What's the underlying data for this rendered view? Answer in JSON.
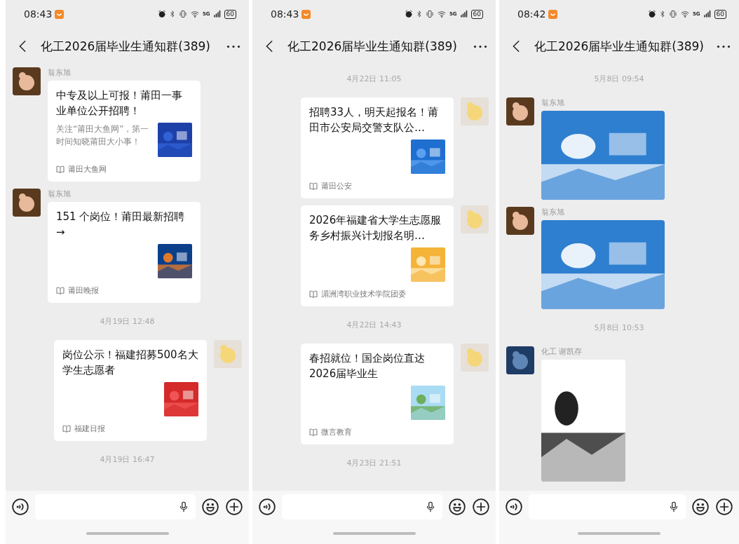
{
  "panels": [
    {
      "status_bar": {
        "time": "08:43",
        "network": "5G",
        "battery": "60"
      },
      "header": {
        "title": "化工2026届毕业生通知群(389)"
      },
      "messages": [
        {
          "kind": "article_in",
          "sender": "翁东旭",
          "title": "中专及以上可报！莆田一事业单位公开招聘！",
          "summary": "关注“莆田大鱼网”，第一时间知晓莆田大小事！",
          "source": "莆田大鱼网"
        },
        {
          "kind": "article_in",
          "sender": "翁东旭",
          "title": "151 个岗位！莆田最新招聘→",
          "source": "莆田晚报"
        },
        {
          "kind": "timestamp",
          "text": "4月19日 12:48"
        },
        {
          "kind": "article_out",
          "title": "岗位公示！福建招募500名大学生志愿者",
          "source": "福建日报"
        },
        {
          "kind": "timestamp",
          "text": "4月19日 16:47"
        }
      ]
    },
    {
      "status_bar": {
        "time": "08:43",
        "network": "5G",
        "battery": "60"
      },
      "header": {
        "title": "化工2026届毕业生通知群(389)"
      },
      "messages": [
        {
          "kind": "timestamp",
          "text": "4月22日 11:05"
        },
        {
          "kind": "article_out",
          "title": "招聘33人，明天起报名！莆田市公安局交警支队公…",
          "source": "莆田公安"
        },
        {
          "kind": "article_out",
          "title": "2026年福建省大学生志愿服务乡村振兴计划报名明…",
          "source": "湄洲湾职业技术学院团委"
        },
        {
          "kind": "timestamp",
          "text": "4月22日 14:43"
        },
        {
          "kind": "article_out",
          "title": "春招就位！国企岗位直达2026届毕业生",
          "source": "微言教育"
        },
        {
          "kind": "timestamp",
          "text": "4月23日 21:51"
        }
      ]
    },
    {
      "status_bar": {
        "time": "08:42",
        "network": "5G",
        "battery": "60"
      },
      "header": {
        "title": "化工2026届毕业生通知群(389)"
      },
      "messages": [
        {
          "kind": "timestamp",
          "text": "5月8日 09:54"
        },
        {
          "kind": "poster",
          "sender": "翁东旭"
        },
        {
          "kind": "poster",
          "sender": "翁东旭"
        },
        {
          "kind": "timestamp",
          "text": "5月8日 10:53"
        },
        {
          "kind": "qr_code",
          "sender": "化工 谢凯存"
        }
      ]
    }
  ]
}
